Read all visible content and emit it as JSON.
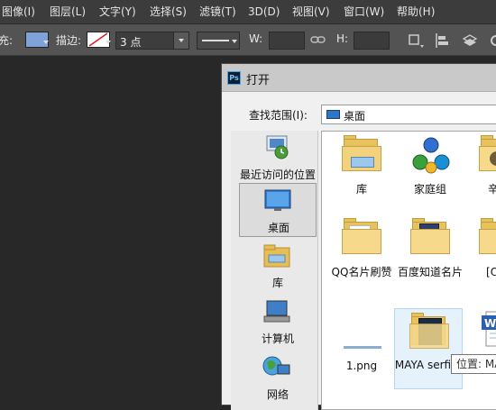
{
  "menu": [
    "图像(I)",
    "图层(L)",
    "文字(Y)",
    "选择(S)",
    "滤镜(T)",
    "3D(D)",
    "视图(V)",
    "窗口(W)",
    "帮助(H)"
  ],
  "options": {
    "fill_label": "填充:",
    "fill_color": "#7fa3d8",
    "stroke_label": "描边:",
    "stroke_width_value": "3 点",
    "w_label": "W:",
    "h_label": "H:"
  },
  "dialog": {
    "app_icon_text": "Ps",
    "title": "打开",
    "look_in_label": "查找范围(I):",
    "look_in_value": "桌面",
    "places": [
      {
        "label": "最近访问的位置",
        "icon": "recent-places-icon"
      },
      {
        "label": "桌面",
        "icon": "desktop-icon",
        "selected": true
      },
      {
        "label": "库",
        "icon": "libraries-icon"
      },
      {
        "label": "计算机",
        "icon": "computer-icon"
      },
      {
        "label": "网络",
        "icon": "network-icon"
      }
    ],
    "files": [
      {
        "label": "库",
        "icon": "libraries-folder-icon"
      },
      {
        "label": "家庭组",
        "icon": "homegroup-icon"
      },
      {
        "label": "辛苦",
        "icon": "user-folder-icon"
      },
      {
        "label": "QQ名片刷赞",
        "icon": "folder-icon"
      },
      {
        "label": "百度知道名片",
        "icon": "folder-icon"
      },
      {
        "label": "[OFF",
        "icon": "folder-icon"
      },
      {
        "label": "1.png",
        "icon": "png-file-icon"
      },
      {
        "label": "MAYA serfice",
        "icon": "folder-icon",
        "selected": true
      },
      {
        "label": "",
        "icon": "word-document-icon"
      }
    ],
    "tooltip": "位置: MA"
  }
}
